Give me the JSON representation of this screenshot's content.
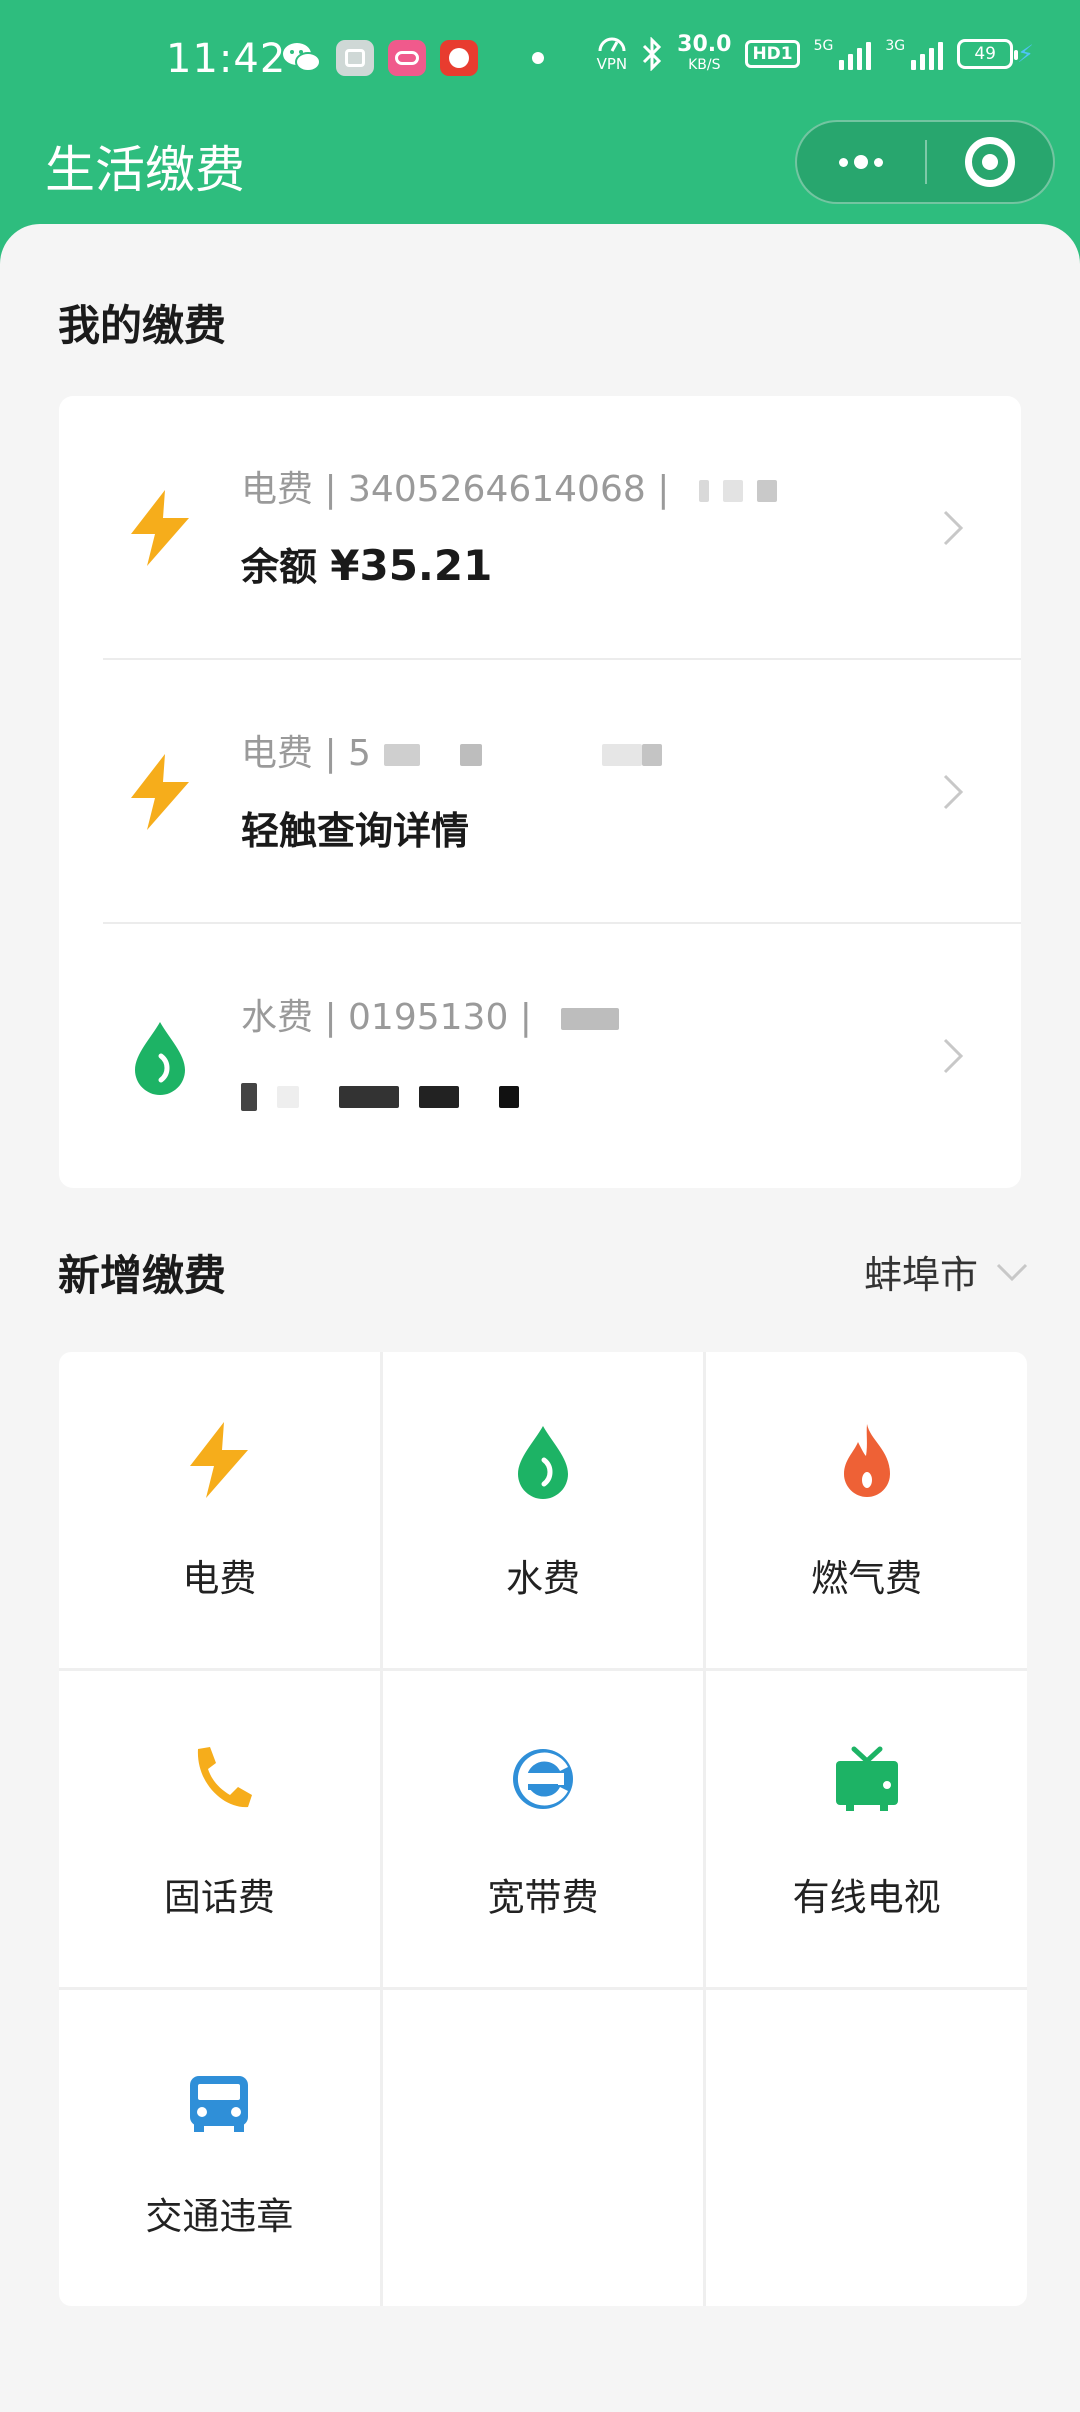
{
  "status_bar": {
    "time": "11:42",
    "icons": [
      "wechat-icon",
      "app-square-icon",
      "app-pink-icon",
      "app-red-icon"
    ],
    "vpn_label": "VPN",
    "speed_value": "30.0",
    "speed_unit": "KB/S",
    "hd_label": "HD1",
    "sig1_label": "5G",
    "sig2_label": "3G",
    "battery": "49"
  },
  "nav": {
    "title": "生活缴费"
  },
  "my_bills": {
    "title": "我的缴费",
    "items": [
      {
        "type": "电费 | 3405264614068 |",
        "main_prefix": "余额",
        "main_value": "¥35.21",
        "icon": "lightning-icon"
      },
      {
        "type": "电费 | 5",
        "main_prefix": "轻触查询详情",
        "main_value": "",
        "icon": "lightning-icon"
      },
      {
        "type": "水费 | 0195130 |",
        "main_prefix": "",
        "main_value": "",
        "icon": "water-drop-icon"
      }
    ]
  },
  "new_bills": {
    "title": "新增缴费",
    "city": "蚌埠市",
    "categories": [
      {
        "label": "电费",
        "icon": "lightning-icon"
      },
      {
        "label": "水费",
        "icon": "water-drop-icon"
      },
      {
        "label": "燃气费",
        "icon": "flame-icon"
      },
      {
        "label": "固话费",
        "icon": "phone-icon"
      },
      {
        "label": "宽带费",
        "icon": "broadband-e-icon"
      },
      {
        "label": "有线电视",
        "icon": "tv-icon"
      },
      {
        "label": "交通违章",
        "icon": "car-icon"
      }
    ]
  },
  "colors": {
    "brand": "#2ebd7e",
    "electric": "#f6ad1b",
    "water": "#1db365",
    "gas": "#ee6136",
    "phone": "#f6ad1b",
    "broadband": "#2f8fd8",
    "tv": "#1db365",
    "traffic": "#2f8fd8"
  }
}
